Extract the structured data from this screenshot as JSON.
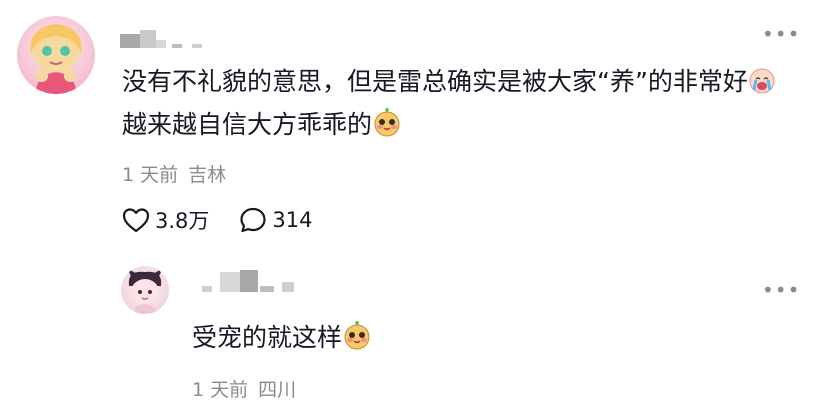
{
  "comment": {
    "text_part1": "没有不礼貌的意思，但是雷总确实是被大家“养”的非常好",
    "text_part2": "越来越自信大方乖乖的",
    "emojis": [
      "crying-emoji",
      "cute-face-emoji"
    ],
    "meta": {
      "time": "1 天前",
      "location": "吉林"
    },
    "likes": "3.8万",
    "replies": "314"
  },
  "reply": {
    "text": "受宠的就这样",
    "emojis": [
      "cute-face-emoji"
    ],
    "meta": {
      "time": "1 天前",
      "location": "四川"
    }
  },
  "colors": {
    "text": "#161823",
    "meta": "#8a8b91",
    "background": "#ffffff"
  }
}
